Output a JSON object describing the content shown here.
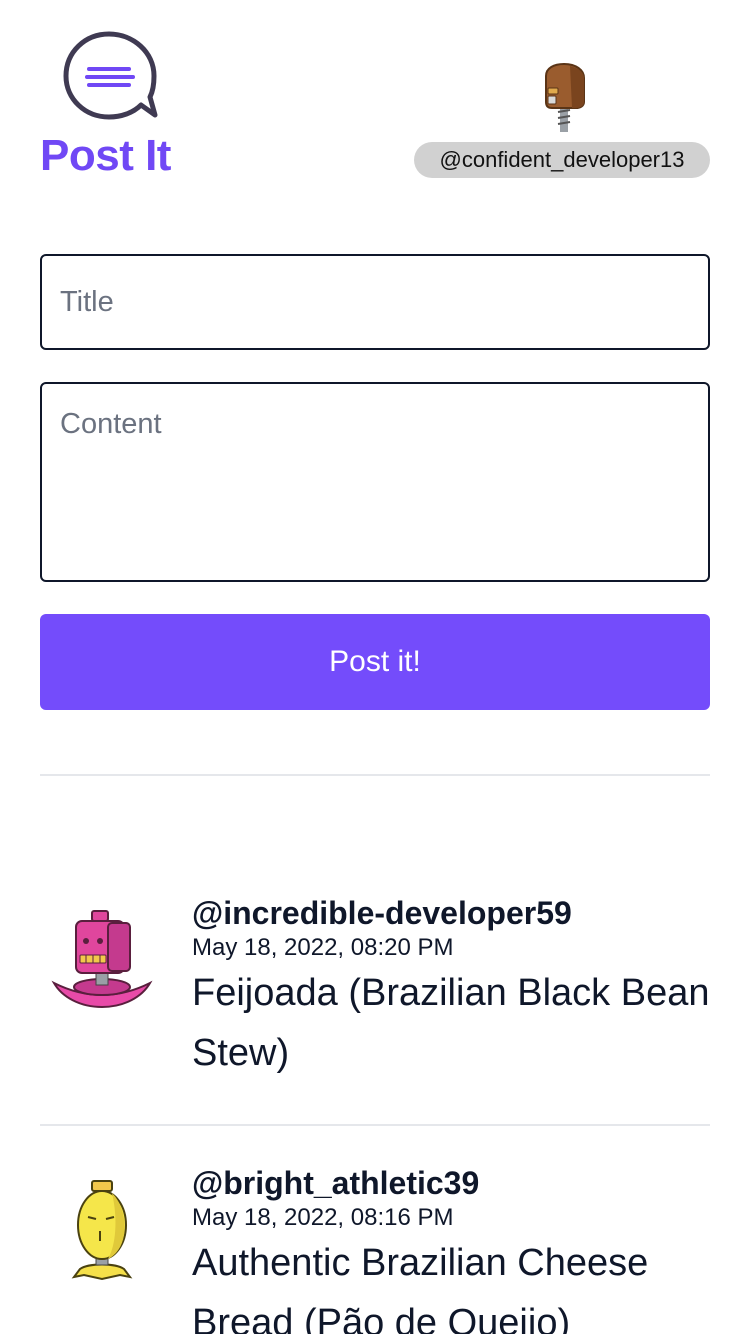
{
  "app": {
    "title": "Post It",
    "username": "@confident_developer13"
  },
  "form": {
    "title_placeholder": "Title",
    "content_placeholder": "Content",
    "submit_label": "Post it!"
  },
  "posts": [
    {
      "author": "@incredible-developer59",
      "date": "May 18, 2022, 08:20 PM",
      "title": "Feijoada (Brazilian Black Bean Stew)",
      "avatar_icon": "pink-robot-avatar"
    },
    {
      "author": "@bright_athletic39",
      "date": "May 18, 2022, 08:16 PM",
      "title": "Authentic Brazilian Cheese Bread (Pão de Queijo)",
      "avatar_icon": "yellow-robot-avatar"
    }
  ],
  "colors": {
    "brand": "#7048f5",
    "button": "#744cfb",
    "chip": "#d1d1d1",
    "text": "#0f172a"
  }
}
